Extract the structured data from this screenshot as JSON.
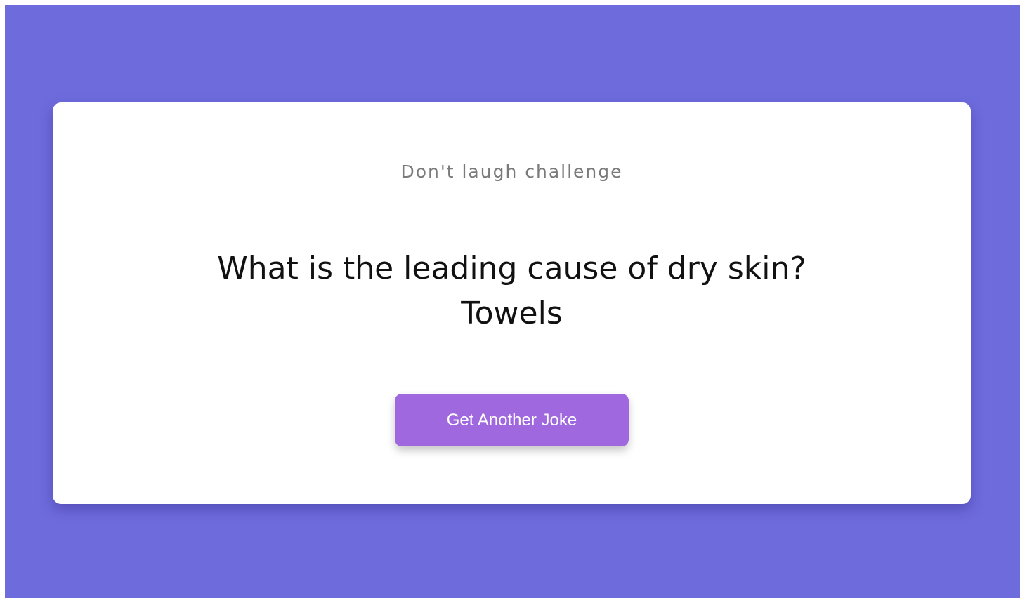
{
  "colors": {
    "background": "#6e6bdd",
    "card": "#ffffff",
    "button": "#9f68de",
    "button_text": "#ffffff",
    "subtitle": "#7a7a7a",
    "joke_text": "#111111"
  },
  "header": {
    "subtitle": "Don't laugh challenge"
  },
  "joke": {
    "question": "What is the leading cause of dry skin?",
    "answer": "Towels"
  },
  "actions": {
    "next_joke_label": "Get Another Joke"
  }
}
